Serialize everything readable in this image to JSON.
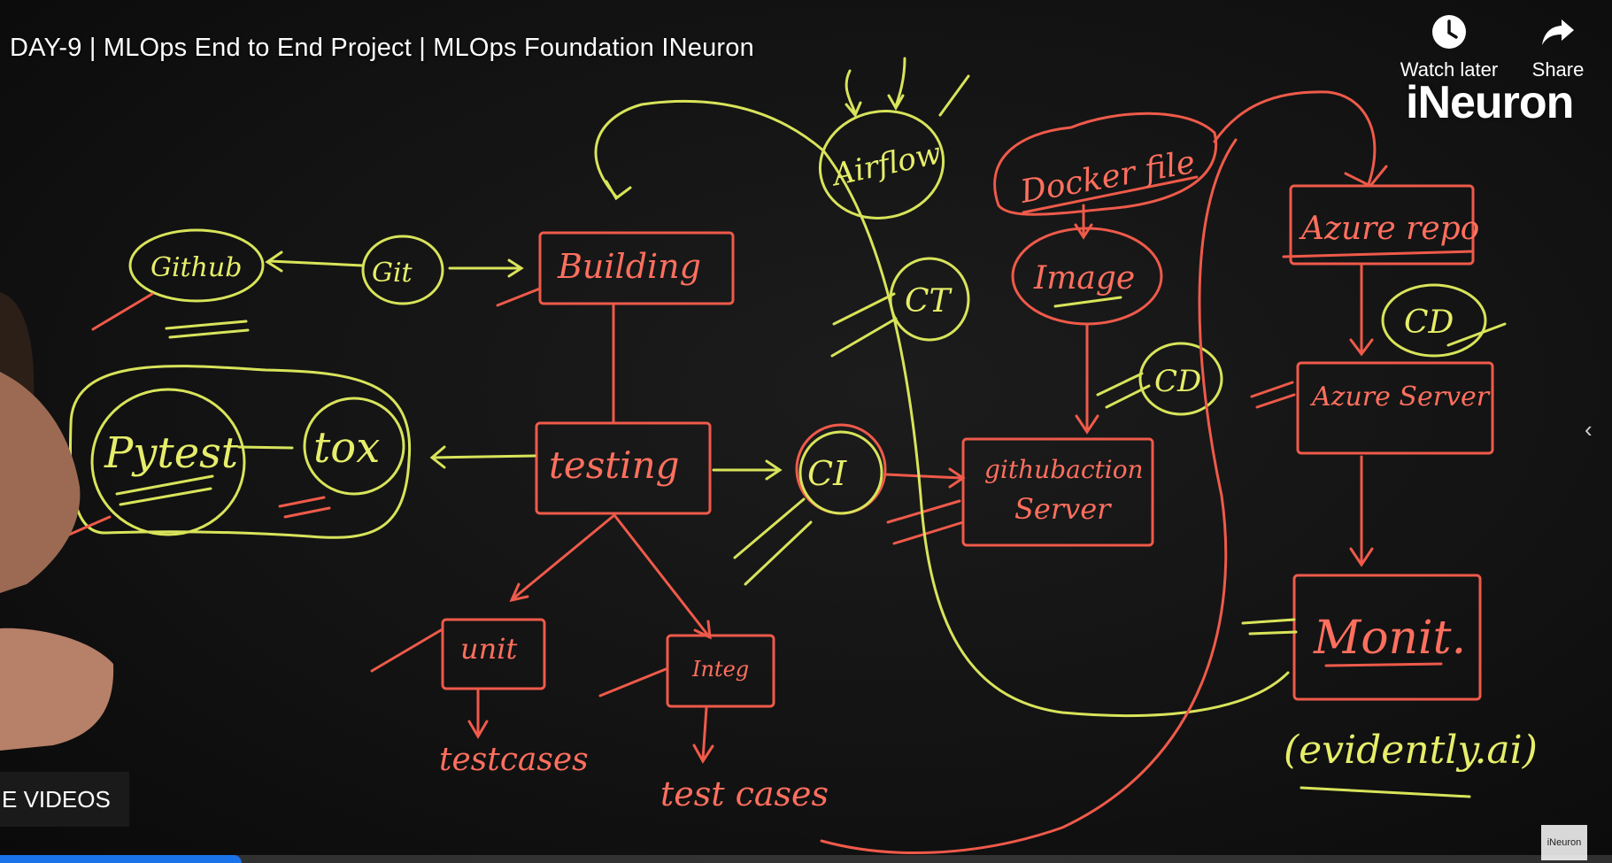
{
  "video": {
    "title": "DAY-9 | MLOps End to End Project | MLOps Foundation INeuron",
    "progress": 0.15
  },
  "top_actions": {
    "watch_later": {
      "label": "Watch later",
      "icon": "clock-icon"
    },
    "share": {
      "label": "Share",
      "icon": "share-arrow-icon"
    }
  },
  "brand": {
    "name": "iNeuron"
  },
  "more_videos": {
    "label": "E VIDEOS"
  },
  "watermark": {
    "label": "iNeuron"
  },
  "side_chevron": {
    "glyph": "‹"
  },
  "whiteboard": {
    "nodes": {
      "github": "Github",
      "git": "Git",
      "building": "Building",
      "airflow": "Airflow",
      "ct": "CT",
      "dockerfile": "Docker file",
      "image": "Image",
      "cd_image": "CD",
      "azure_repo": "Azure repo",
      "cd_azure": "CD",
      "azure_server": "Azure Server",
      "pytest": "Pytest",
      "tox": "tox",
      "testing": "testing",
      "ci": "CI",
      "github_actions_server_line1": "githubaction",
      "github_actions_server_line2": "Server",
      "unit": "unit",
      "integ": "Integ",
      "testcases_left": "testcases",
      "testcases_right": "test cases",
      "monit": "Monit.",
      "evidently": "(evidently.ai)"
    }
  },
  "colors": {
    "yellow_marker": "#e6ee6a",
    "red_marker": "#ff6f5e",
    "progress": "#1a73e8"
  }
}
